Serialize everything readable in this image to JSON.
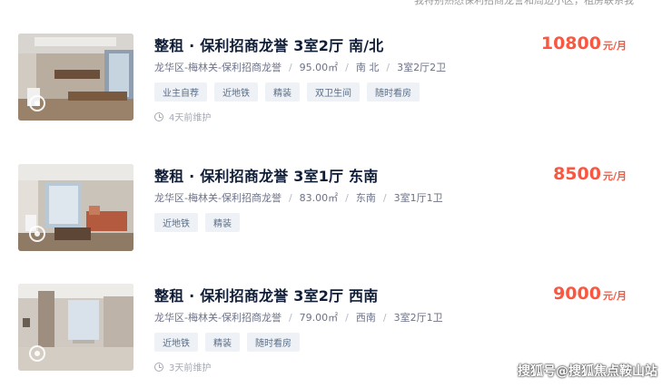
{
  "top_note": "我特别熟悉保利招商龙誉和周边小区，租房联系我",
  "listings": [
    {
      "title": "整租 · 保利招商龙誉 3室2厅 南/北",
      "price": "10800",
      "price_unit": "元/月",
      "location": "龙华区-梅林关-保利招商龙誉",
      "area": "95.00㎡",
      "orientation": "南 北",
      "layout": "3室2厅2卫",
      "tags": [
        "业主自荐",
        "近地铁",
        "精装",
        "双卫生间",
        "随时看房"
      ],
      "maintained": "4天前维护"
    },
    {
      "title": "整租 · 保利招商龙誉 3室1厅 东南",
      "price": "8500",
      "price_unit": "元/月",
      "location": "龙华区-梅林关-保利招商龙誉",
      "area": "83.00㎡",
      "orientation": "东南",
      "layout": "3室1厅1卫",
      "tags": [
        "近地铁",
        "精装"
      ],
      "maintained": ""
    },
    {
      "title": "整租 · 保利招商龙誉 3室2厅 西南",
      "price": "9000",
      "price_unit": "元/月",
      "location": "龙华区-梅林关-保利招商龙誉",
      "area": "79.00㎡",
      "orientation": "西南",
      "layout": "3室2厅1卫",
      "tags": [
        "近地铁",
        "精装",
        "随时看房"
      ],
      "maintained": "3天前维护"
    }
  ],
  "separator": "/",
  "watermark": "搜狐号@搜狐焦点鞍山站",
  "colors": {
    "title": "#101d37",
    "price": "#fa5741",
    "tag_bg": "#eef2f6",
    "tag_text": "#5b6d86",
    "meta_text": "#6d7287"
  }
}
